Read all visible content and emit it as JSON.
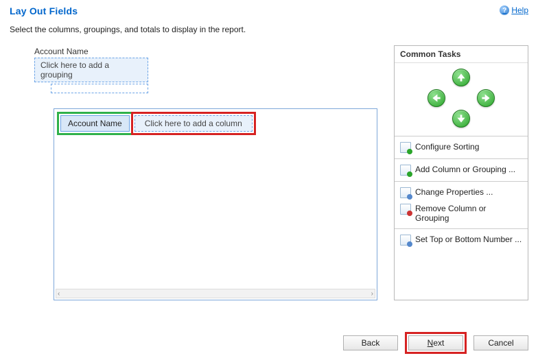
{
  "header": {
    "title": "Lay Out Fields",
    "help_label": "Help"
  },
  "instruction": "Select the columns, groupings, and totals to display in the report.",
  "grouping": {
    "root_label": "Account Name",
    "add_grouping_placeholder": "Click here to add a grouping"
  },
  "columns": {
    "selected": "Account Name",
    "add_placeholder": "Click here to add a column"
  },
  "tasks": {
    "header": "Common Tasks",
    "configure_sorting": "Configure Sorting",
    "add_column": "Add Column or Grouping ...",
    "change_props": "Change Properties ...",
    "remove_column": "Remove Column or Grouping",
    "set_top": "Set Top or Bottom Number ..."
  },
  "footer": {
    "back": "Back",
    "next_prefix": "N",
    "next_rest": "ext",
    "cancel": "Cancel"
  }
}
